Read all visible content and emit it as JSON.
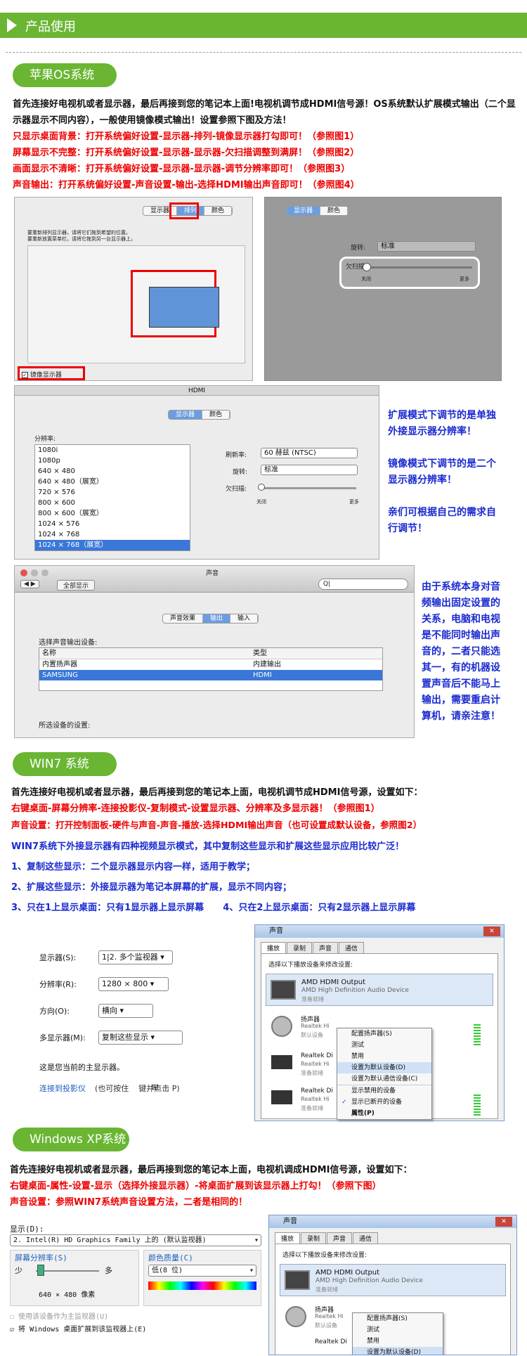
{
  "header": {
    "title": "产品使用"
  },
  "mac": {
    "pill": "苹果OS系统",
    "intro": "首先连接好电视机或者显示器，最后再接到您的笔记本上面!电视机调节成HDMI信号源！OS系统默认扩展模式输出（二个显示器显示不同内容），一般使用镜像模式输出！设置参照下图及方法！",
    "tip1": "只显示桌面背景：打开系统偏好设置-显示器-排列-镜像显示器打勾即可！（参照图1）",
    "tip2": "屏幕显示不完整：打开系统偏好设置-显示器-显示器-欠扫描调整到满屏！（参照图2）",
    "tip3": "画面显示不清晰：打开系统偏好设置-显示器-显示器-调节分辨率即可！（参照图3）",
    "tip4": "声音输出：打开系统偏好设置-声音设置-输出-选择HDMI输出声音即可！（参照图4）",
    "fig1": {
      "tabs": [
        "显示器",
        "排列",
        "颜色"
      ],
      "hint1": "要重新排列显示器，请将它们拖到希望的位置。",
      "hint2": "要重新放置菜单栏，请将它拖到另一台显示器上。",
      "mirror": "镜像显示器"
    },
    "fig2": {
      "tabs": [
        "显示器",
        "颜色"
      ],
      "rotate_label": "旋转:",
      "rotate_value": "标准",
      "underscan": "欠扫描",
      "off": "关闭",
      "more": "更多"
    },
    "fig3": {
      "title": "HDMI",
      "tabs": [
        "显示器",
        "颜色"
      ],
      "res_label": "分辨率:",
      "resolutions": [
        "1080i",
        "1080p",
        "640 × 480",
        "640 × 480（展宽）",
        "720 × 576",
        "800 × 600",
        "800 × 600（展宽）",
        "1024 × 576",
        "1024 × 768",
        "1024 × 768（展宽）"
      ],
      "refresh_label": "刷新率:",
      "refresh_value": "60 赫兹 (NTSC)",
      "rotate_label": "旋转:",
      "rotate_value": "标准",
      "underscan_label": "欠扫描:",
      "off": "关闭",
      "more": "更多"
    },
    "note1": [
      "扩展模式下调节的是单独",
      "外接显示器分辨率！",
      "",
      "镜像模式下调节的是二个",
      "显示器分辨率！",
      "",
      "亲们可根据自己的需求自",
      "行调节！"
    ],
    "fig4": {
      "title": "声音",
      "show_all": "全部显示",
      "search": "Q|",
      "tabs": [
        "声音效果",
        "输出",
        "输入"
      ],
      "choose": "选择声音输出设备:",
      "col_name": "名称",
      "col_type": "类型",
      "rows": [
        [
          "内置扬声器",
          "内建输出"
        ],
        [
          "SAMSUNG",
          "HDMI"
        ]
      ],
      "selected": "所选设备的设置:"
    },
    "note2": [
      "由于系统本身对音",
      "频输出固定设置的",
      "关系，电脑和电视",
      "是不能同时输出声",
      "音的，二者只能选",
      "其一，有的机器设",
      "置声音后不能马上",
      "输出，需要重启计",
      "算机，请亲注意！"
    ]
  },
  "win7": {
    "pill": "WIN7 系统",
    "intro": "首先连接好电视机或者显示器，最后再接到您的笔记本上面，电视机调节成HDMI信号源，设置如下：",
    "tip1": "右键桌面-屏幕分辨率-连接投影仪-复制模式-设置显示器、分辨率及多显示器！（参照图1）",
    "tip2": "声音设置：打开控制面板-硬件与声音-声音-播放-选择HDMI输出声音（也可设置成默认设备，参照图2）",
    "line3": "WIN7系统下外接显示器有四种视频显示模式，其中复制这些显示和扩展这些显示应用比较广泛！",
    "line4": "1、复制这些显示：二个显示器显示内容一样，适用于教学；",
    "line5": "2、扩展这些显示：外接显示器为笔记本屏幕的扩展，显示不同内容；",
    "line6": "3、只在1上显示桌面：只有1显示器上显示屏幕      4、只在2上显示桌面：只有2显示器上显示屏幕",
    "fig1": {
      "display_label": "显示器(S):",
      "display_value": "1|2. 多个监视器",
      "res_label": "分辨率(R):",
      "res_value": "1280 × 800",
      "orient_label": "方向(O):",
      "orient_value": "横向",
      "multi_label": "多显示器(M):",
      "multi_value": "复制这些显示",
      "main_text": "这是您当前的主显示器。",
      "link": "连接到投影仪",
      "link_tail": "(也可按住    键并点击 P)"
    },
    "fig2": {
      "title": "声音",
      "tabs": [
        "播放",
        "录制",
        "声音",
        "通信"
      ],
      "prompt": "选择以下播放设备来修改设置:",
      "dev1_name": "AMD HDMI Output",
      "dev1_sub": "AMD High Definition Audio Device",
      "dev1_state": "准备就绪",
      "dev2_name": "扬声器",
      "dev2_sub": "Realtek Hi",
      "dev2_state": "默认设备",
      "dev3_name": "Realtek Di",
      "dev3_sub": "Realtek Hi",
      "dev3_state": "准备就绪",
      "dev4_name": "Realtek Di",
      "dev4_sub": "Realtek Hi",
      "dev4_state": "准备就绪",
      "menu": [
        "配置扬声器(S)",
        "测试",
        "禁用",
        "设置为默认设备(D)",
        "设置为默认通信设备(C)",
        "显示禁用的设备",
        "显示已断开的设备",
        "属性(P)"
      ]
    }
  },
  "xp": {
    "pill": "Windows XP系统",
    "intro": "首先连接好电视机或者显示器，最后再接到您的笔记本上面，电视机调成HDMI信号源，设置如下：",
    "tip1": "右键桌面-属性-设置-显示（选择外接显示器）-将桌面扩展到该显示器上打勾！（参照下图）",
    "tip2": "声音设置：参照WIN7系统声音设置方法，二者是相同的！",
    "fig1": {
      "display_label": "显示(D):",
      "display_value": "2. Intel(R) HD Graphics Family 上的 (默认监视器)",
      "res_label": "屏幕分辨率(S)",
      "less": "少",
      "more": "多",
      "res_value": "640 × 480 像素",
      "color_label": "颜色质量(C)",
      "color_value": "低(8 位)",
      "primary": "使用该设备作为主监视器(U)",
      "extend": "将 Windows 桌面扩展到该监视器上(E)"
    },
    "fig2": {
      "title": "声音",
      "tabs": [
        "播放",
        "录制",
        "声音",
        "通信"
      ],
      "prompt": "选择以下播放设备来修改设置:",
      "dev1_name": "AMD HDMI Output",
      "dev1_sub": "AMD High Definition Audio Device",
      "dev1_state": "准备就绪",
      "dev2_name": "扬声器",
      "dev2_sub": "Realtek Hi",
      "dev2_state": "默认设备",
      "dev3_name": "Realtek Di",
      "menu": [
        "配置扬声器(S)",
        "测试",
        "禁用",
        "设置为默认设备(D)"
      ]
    }
  }
}
